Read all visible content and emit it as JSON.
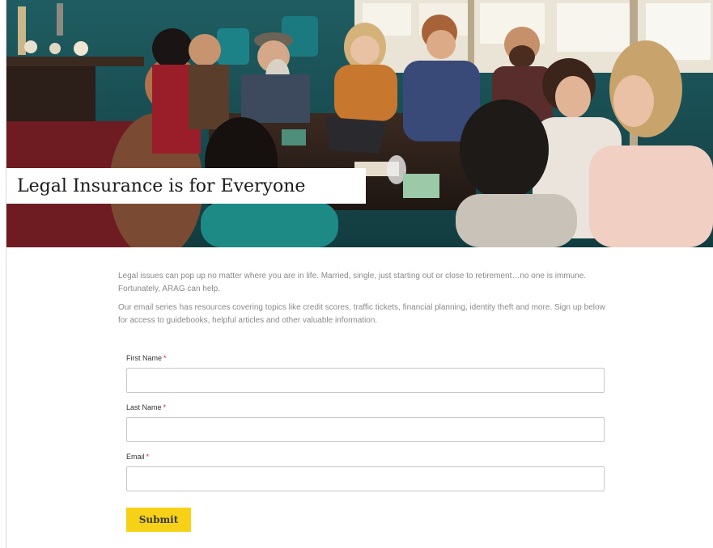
{
  "hero": {
    "title": "Legal Insurance is for Everyone"
  },
  "intro": {
    "paragraph1": "Legal issues can pop up no matter where you are in life. Married, single, just starting out or close to retirement…no one is immune. Fortunately, ARAG can help.",
    "paragraph2": "Our email series has resources covering topics like credit scores, traffic tickets, financial planning, identity theft and more. Sign up below for access to guidebooks, helpful articles and other valuable information."
  },
  "form": {
    "first_name": {
      "label": "First Name",
      "required_mark": "*",
      "value": ""
    },
    "last_name": {
      "label": "Last Name",
      "required_mark": "*",
      "value": ""
    },
    "email": {
      "label": "Email",
      "required_mark": "*",
      "value": ""
    },
    "submit_label": "Submit"
  },
  "colors": {
    "accent_yellow": "#f7d117",
    "wall_teal": "#1e5a5e",
    "required_red": "#c62828"
  }
}
